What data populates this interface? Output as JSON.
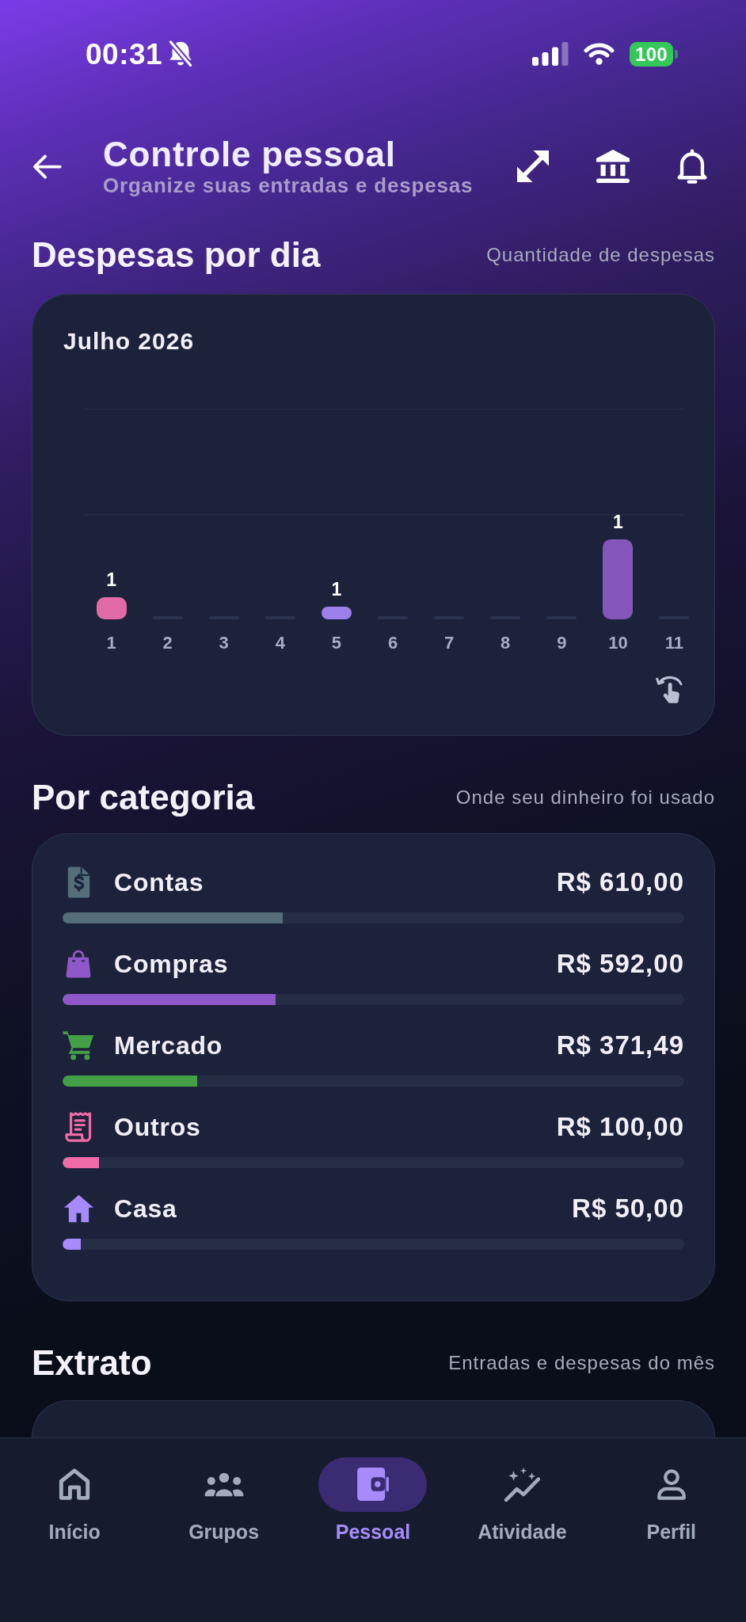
{
  "status_bar": {
    "time": "00:31",
    "battery": "100"
  },
  "header": {
    "title": "Controle pessoal",
    "subtitle": "Organize suas entradas e despesas"
  },
  "expenses_by_day": {
    "title": "Despesas por dia",
    "caption": "Quantidade de despesas",
    "chart": {
      "title": "Julho 2026",
      "bars": [
        {
          "day": "1",
          "value_label": "1",
          "color": "#e06aa6"
        },
        {
          "day": "2"
        },
        {
          "day": "3"
        },
        {
          "day": "4"
        },
        {
          "day": "5",
          "value_label": "1",
          "color": "#9d80ea"
        },
        {
          "day": "6"
        },
        {
          "day": "7"
        },
        {
          "day": "8"
        },
        {
          "day": "9"
        },
        {
          "day": "10",
          "value_label": "1",
          "color": "#8456b9"
        },
        {
          "day": "11"
        }
      ]
    }
  },
  "by_category": {
    "title": "Por categoria",
    "caption": "Onde seu dinheiro foi usado",
    "categories": [
      {
        "kind": "bills",
        "name": "Contas",
        "amount": "R$ 610,00",
        "level": 0.354,
        "color": "#546e7a"
      },
      {
        "kind": "shopping",
        "name": "Compras",
        "amount": "R$ 592,00",
        "level": 0.343,
        "color": "#8e58c8"
      },
      {
        "kind": "grocery",
        "name": "Mercado",
        "amount": "R$ 371,49",
        "level": 0.216,
        "color": "#43a047"
      },
      {
        "kind": "other",
        "name": "Outros",
        "amount": "R$ 100,00",
        "level": 0.058,
        "color": "#f06ba8"
      },
      {
        "kind": "home",
        "name": "Casa",
        "amount": "R$ 50,00",
        "level": 0.029,
        "color": "#a78bfa"
      }
    ]
  },
  "statement": {
    "title": "Extrato",
    "caption": "Entradas e despesas do mês"
  },
  "bottom_nav": [
    {
      "kind": "home",
      "label": "Início",
      "selected": false
    },
    {
      "kind": "groups",
      "label": "Grupos",
      "selected": false
    },
    {
      "kind": "personal",
      "label": "Pessoal",
      "selected": true
    },
    {
      "kind": "activity",
      "label": "Atividade",
      "selected": false
    },
    {
      "kind": "profile",
      "label": "Perfil",
      "selected": false
    }
  ]
}
